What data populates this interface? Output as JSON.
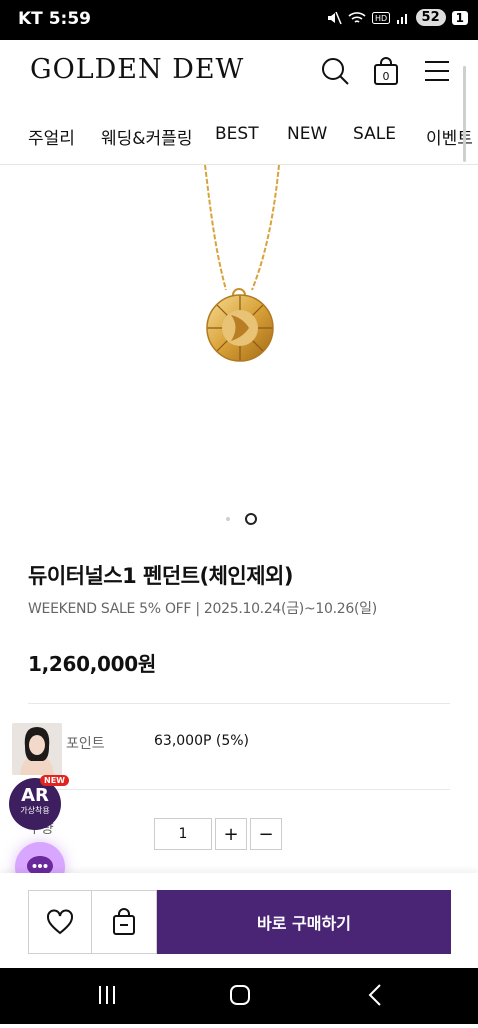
{
  "status_bar": {
    "carrier": "KT",
    "time": "5:59",
    "battery": "52",
    "sim": "1"
  },
  "header": {
    "logo": "GOLDEN DEW"
  },
  "nav": {
    "items": [
      "주얼리",
      "웨딩&커플링",
      "BEST",
      "NEW",
      "SALE",
      "이벤트"
    ]
  },
  "gallery": {
    "total_slides": 2,
    "active_slide": 2
  },
  "product": {
    "title": "듀이터널스1 펜던트(체인제외)",
    "subtitle": "WEEKEND SALE 5% OFF | 2025.10.24(금)~10.26(일)",
    "price": "1,260,000원",
    "points_label": "포인트",
    "points_value": "63,000P (5%)",
    "quantity_label": "수량",
    "quantity_value": "1",
    "plus": "+",
    "minus": "−"
  },
  "floating": {
    "ar_title": "AR",
    "ar_sub": "가상착용",
    "new_badge": "NEW"
  },
  "bottom": {
    "buy_label": "바로 구매하기"
  },
  "colors": {
    "brand_purple": "#4a2576",
    "gold": "#d9a23a",
    "chat_bubble": "#d9a6ff"
  }
}
